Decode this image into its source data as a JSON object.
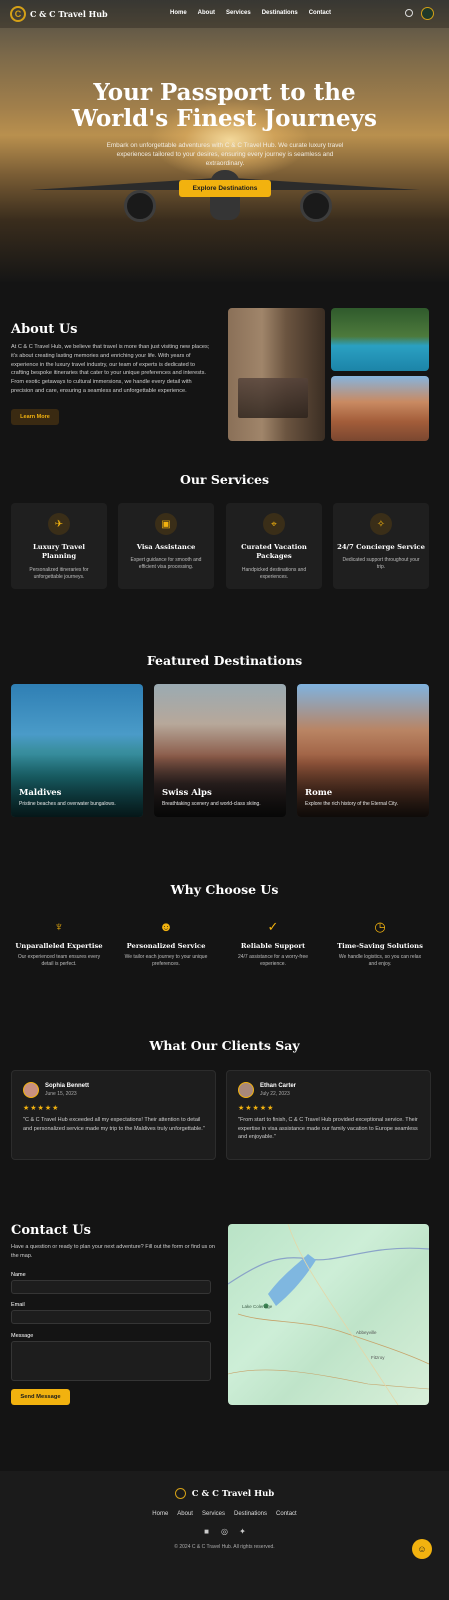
{
  "nav": {
    "brand": "C & C Travel Hub",
    "links": [
      "Home",
      "About",
      "Services",
      "Destinations",
      "Contact"
    ]
  },
  "hero": {
    "title_line1": "Your Passport to the",
    "title_line2": "World's Finest Journeys",
    "subtitle": "Embark on unforgettable adventures with C & C Travel Hub. We curate luxury travel experiences tailored to your desires, ensuring every journey is seamless and extraordinary.",
    "cta": "Explore Destinations"
  },
  "about": {
    "title": "About Us",
    "text": "At C & C Travel Hub, we believe that travel is more than just visiting new places; it's about creating lasting memories and enriching your life. With years of experience in the luxury travel industry, our team of experts is dedicated to crafting bespoke itineraries that cater to your unique preferences and interests. From exotic getaways to cultural immersions, we handle every detail with precision and care, ensuring a seamless and unforgettable experience.",
    "button": "Learn More"
  },
  "services": {
    "title": "Our Services",
    "items": [
      {
        "icon": "airplane-icon",
        "title": "Luxury Travel Planning",
        "desc": "Personalized itineraries for unforgettable journeys."
      },
      {
        "icon": "passport-icon",
        "title": "Visa Assistance",
        "desc": "Expert guidance for smooth and efficient visa processing."
      },
      {
        "icon": "map-pin-icon",
        "title": "Curated Vacation Packages",
        "desc": "Handpicked destinations and experiences."
      },
      {
        "icon": "concierge-icon",
        "title": "24/7 Concierge Service",
        "desc": "Dedicated support throughout your trip."
      }
    ]
  },
  "destinations": {
    "title": "Featured Destinations",
    "items": [
      {
        "name": "Maldives",
        "desc": "Pristine beaches and overwater bungalows."
      },
      {
        "name": "Swiss Alps",
        "desc": "Breathtaking scenery and world-class skiing."
      },
      {
        "name": "Rome",
        "desc": "Explore the rich history of the Eternal City."
      }
    ]
  },
  "why": {
    "title": "Why Choose Us",
    "items": [
      {
        "icon": "award-icon",
        "title": "Unparalleled Expertise",
        "desc": "Our experienced team ensures every detail is perfect."
      },
      {
        "icon": "users-icon",
        "title": "Personalized Service",
        "desc": "We tailor each journey to your unique preferences."
      },
      {
        "icon": "shield-check-icon",
        "title": "Reliable Support",
        "desc": "24/7 assistance for a worry-free experience."
      },
      {
        "icon": "clock-icon",
        "title": "Time-Saving Solutions",
        "desc": "We handle logistics, so you can relax and enjoy."
      }
    ]
  },
  "testimonials": {
    "title": "What Our Clients Say",
    "items": [
      {
        "name": "Sophia Bennett",
        "date": "June 15, 2023",
        "stars": "★★★★★",
        "text": "\"C & C Travel Hub exceeded all my expectations! Their attention to detail and personalized service made my trip to the Maldives truly unforgettable.\""
      },
      {
        "name": "Ethan Carter",
        "date": "July 22, 2023",
        "stars": "★★★★★",
        "text": "\"From start to finish, C & C Travel Hub provided exceptional service. Their expertise in visa assistance made our family vacation to Europe seamless and enjoyable.\""
      }
    ]
  },
  "contact": {
    "title": "Contact Us",
    "subtitle": "Have a question or ready to plan your next adventure? Fill out the form or find us on the map.",
    "name_label": "Name",
    "email_label": "Email",
    "message_label": "Message",
    "button": "Send Message",
    "map_labels": [
      "Abbeyville",
      "Fitzroy",
      "Lake Coleridge"
    ]
  },
  "footer": {
    "brand": "C & C Travel Hub",
    "links": [
      "Home",
      "About",
      "Services",
      "Destinations",
      "Contact"
    ],
    "copyright": "© 2024 C & C Travel Hub. All rights reserved."
  },
  "colors": {
    "accent": "#f2b20f",
    "background": "#141414",
    "card": "#1f1f1f"
  }
}
